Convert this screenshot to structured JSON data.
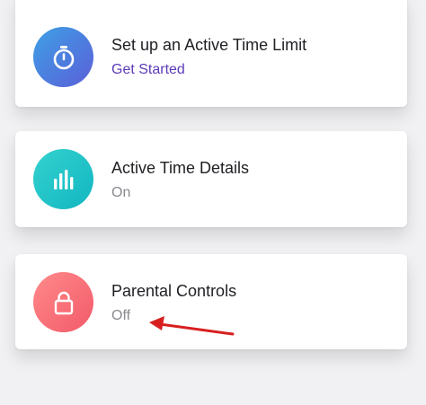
{
  "cards": [
    {
      "title": "Set up an Active Time Limit",
      "subtitle": "Get Started",
      "icon": "stopwatch-icon",
      "subtitle_color": "#5b3bb8"
    },
    {
      "title": "Active Time Details",
      "subtitle": "On",
      "icon": "bar-chart-icon"
    },
    {
      "title": "Parental Controls",
      "subtitle": "Off",
      "icon": "lock-icon"
    }
  ],
  "annotation": {
    "type": "arrow",
    "color": "#d81f1f",
    "points_to": "Off"
  },
  "colors": {
    "background": "#f1f1f4",
    "card_1_icon": "#4d7ee0",
    "card_2_icon": "#22c4c8",
    "card_3_icon": "#f66d78"
  }
}
